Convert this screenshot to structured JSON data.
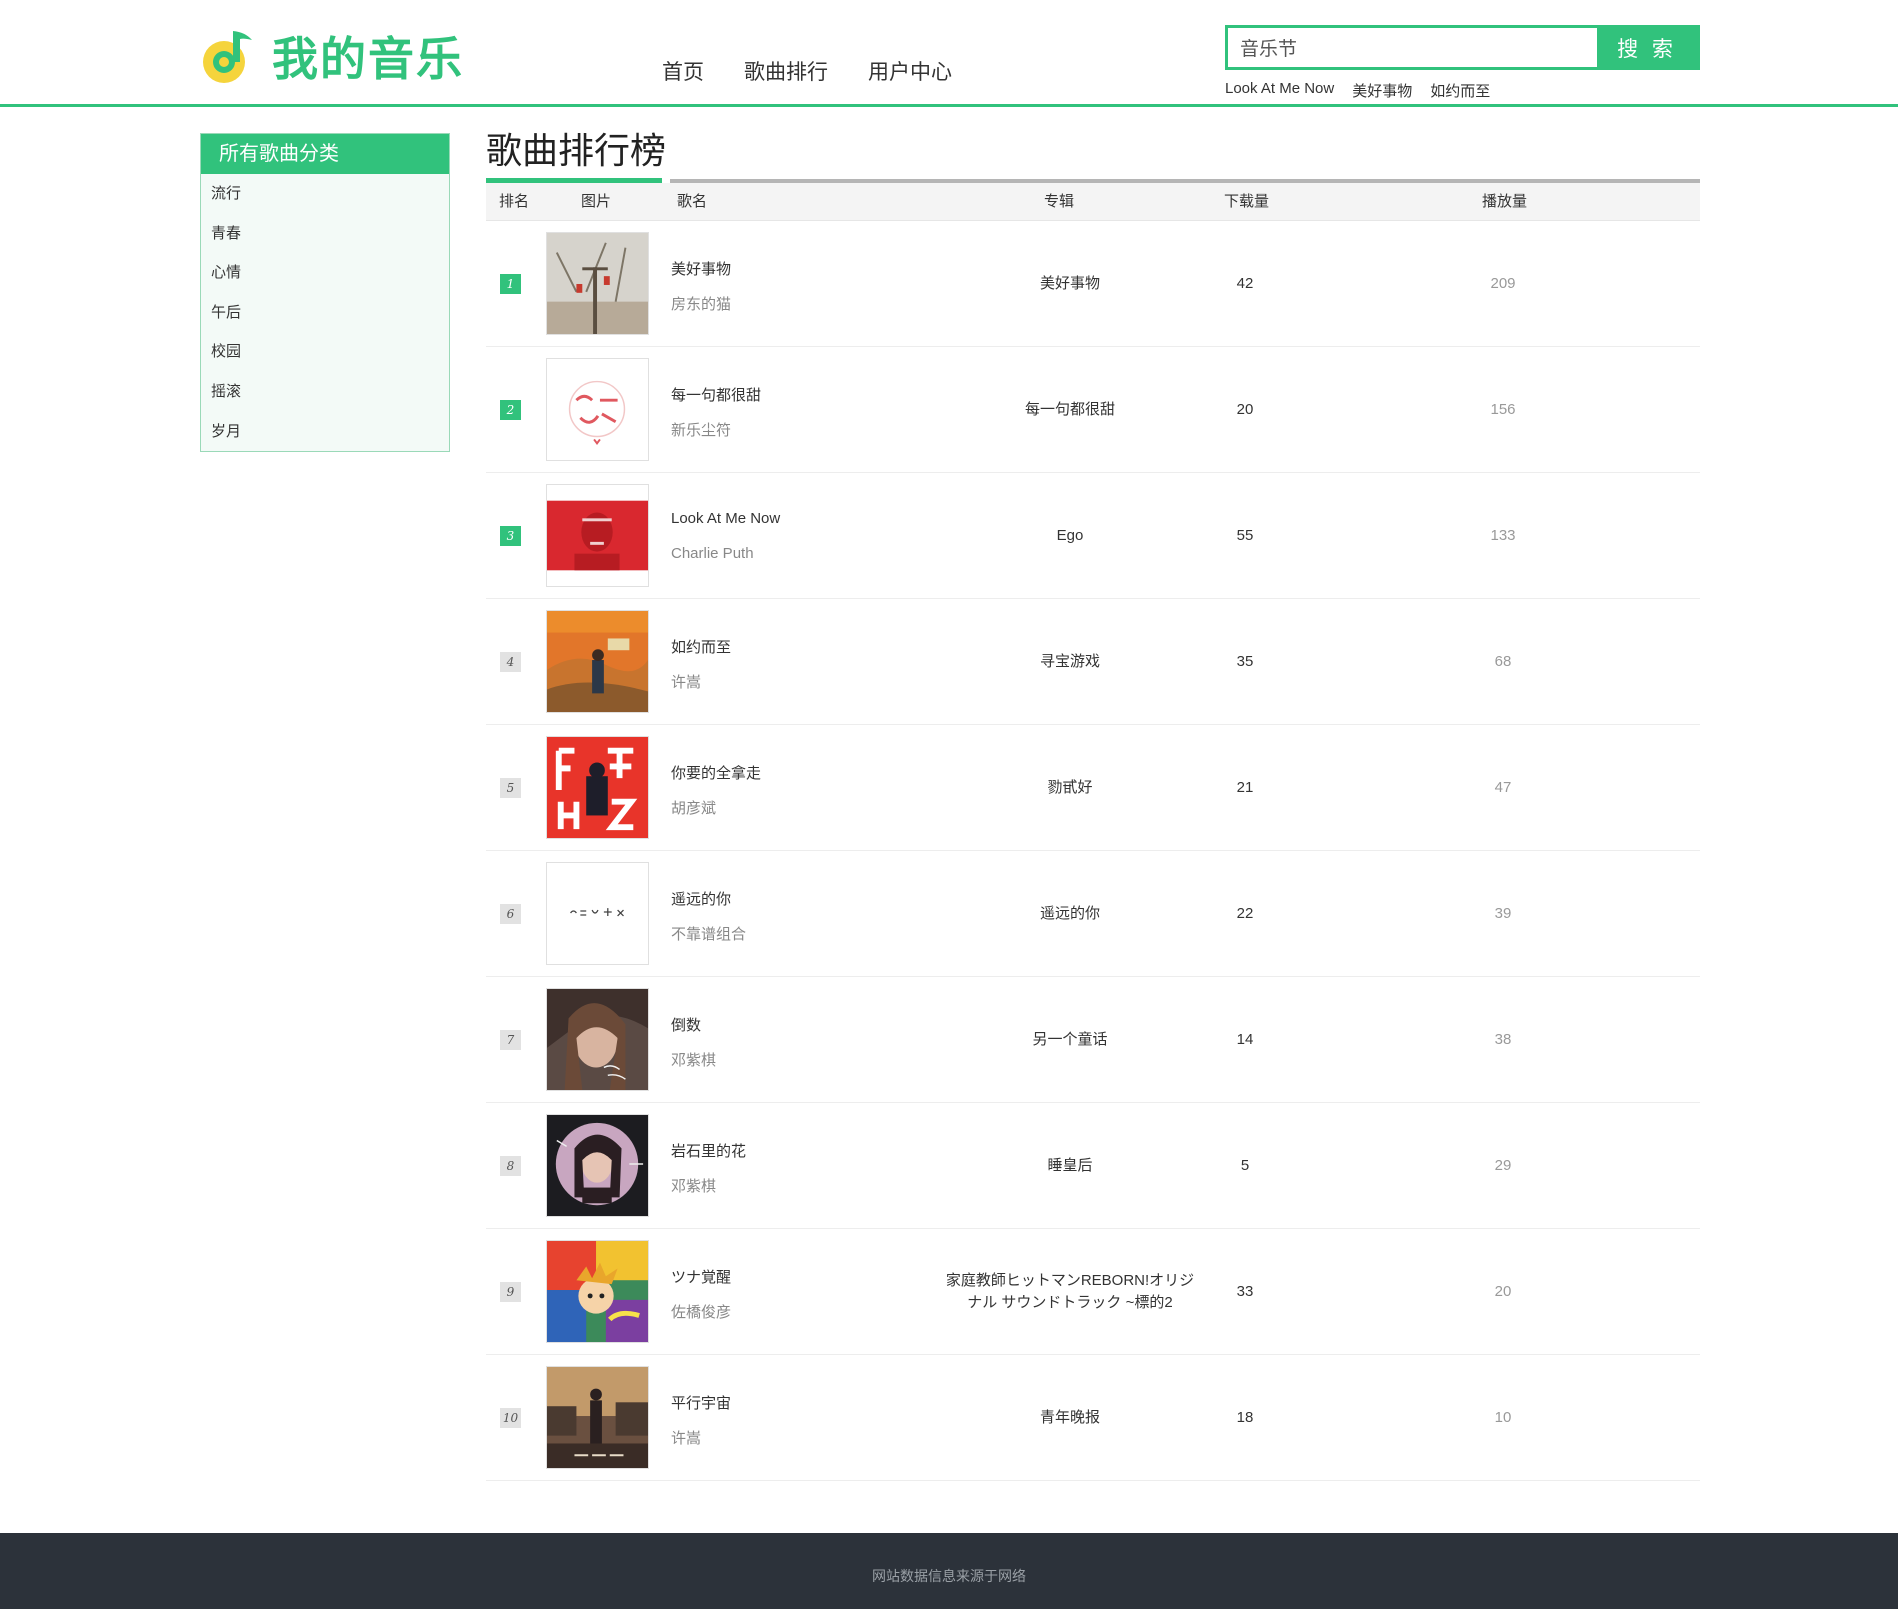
{
  "header": {
    "logo_text": "我的音乐",
    "nav": [
      "首页",
      "歌曲排行",
      "用户中心"
    ],
    "search": {
      "value": "音乐节",
      "button_label": "搜 索"
    },
    "hot_words": [
      "Look At Me Now",
      "美好事物",
      "如约而至"
    ]
  },
  "sidebar": {
    "title": "所有歌曲分类",
    "items": [
      "流行",
      "青春",
      "心情",
      "午后",
      "校园",
      "摇滚",
      "岁月"
    ]
  },
  "main": {
    "title": "歌曲排行榜",
    "columns": {
      "rank": "排名",
      "image": "图片",
      "song": "歌名",
      "album": "专辑",
      "downloads": "下载量",
      "plays": "播放量"
    },
    "rows": [
      {
        "rank": "1",
        "song": "美好事物",
        "singer": "房东的猫",
        "album": "美好事物",
        "downloads": "42",
        "plays": "209",
        "cover": "cover-landscape"
      },
      {
        "rank": "2",
        "song": "每一句都很甜",
        "singer": "新乐尘符",
        "album": "每一句都很甜",
        "downloads": "20",
        "plays": "156",
        "cover": "cover-text-pink"
      },
      {
        "rank": "3",
        "song": "Look At Me Now",
        "singer": "Charlie Puth",
        "album": "Ego",
        "downloads": "55",
        "plays": "133",
        "cover": "cover-red"
      },
      {
        "rank": "4",
        "song": "如约而至",
        "singer": "许嵩",
        "album": "寻宝游戏",
        "downloads": "35",
        "plays": "68",
        "cover": "cover-orange"
      },
      {
        "rank": "5",
        "song": "你要的全拿走",
        "singer": "胡彦斌",
        "album": "勠甙好",
        "downloads": "21",
        "plays": "47",
        "cover": "cover-red-letters"
      },
      {
        "rank": "6",
        "song": "遥远的你",
        "singer": "不靠谱组合",
        "album": "遥远的你",
        "downloads": "22",
        "plays": "39",
        "cover": "cover-white-text"
      },
      {
        "rank": "7",
        "song": "倒数",
        "singer": "邓紫棋",
        "album": "另一个童话",
        "downloads": "14",
        "plays": "38",
        "cover": "cover-portrait"
      },
      {
        "rank": "8",
        "song": "岩石里的花",
        "singer": "邓紫棋",
        "album": "睡皇后",
        "downloads": "5",
        "plays": "29",
        "cover": "cover-circle-portrait"
      },
      {
        "rank": "9",
        "song": "ツナ覚醒",
        "singer": "佐橋俊彦",
        "album": "家庭教師ヒットマンREBORN!オリジナル サウンドトラック ~標的2",
        "downloads": "33",
        "plays": "20",
        "cover": "cover-anime"
      },
      {
        "rank": "10",
        "song": "平行宇宙",
        "singer": "许嵩",
        "album": "青年晚报",
        "downloads": "18",
        "plays": "10",
        "cover": "cover-dusk"
      }
    ]
  },
  "footer": {
    "text": "网站数据信息来源于网络"
  },
  "colors": {
    "accent": "#31c27c",
    "footer_bg": "#2c323a"
  }
}
